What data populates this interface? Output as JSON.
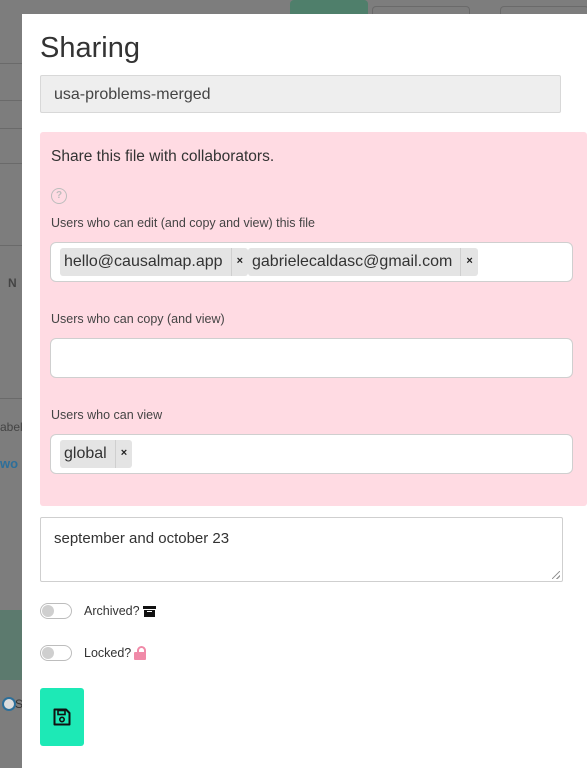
{
  "background": {
    "partial_text_1": "N",
    "partial_text_2": "abel",
    "partial_link": "wo",
    "partial_radio_label": "S"
  },
  "modal": {
    "title": "Sharing",
    "filename": "usa-problems-merged",
    "share_section": {
      "intro": "Share this file with collaborators.",
      "help_icon": "question-circle-icon",
      "editors_label": "Users who can edit (and copy and view) this file",
      "editors": [
        "hello@causalmap.app",
        "gabrielecaldasc@gmail.com"
      ],
      "copiers_label": "Users who can copy (and view)",
      "copiers": [],
      "viewers_label": "Users who can view",
      "viewers": [
        "global"
      ],
      "remove_glyph": "×",
      "background_color": "#ffdbe3"
    },
    "notes": "september and october 23",
    "archived_label": "Archived?",
    "archived": false,
    "archived_icon": "archive-icon",
    "locked_label": "Locked?",
    "locked": false,
    "locked_icon": "lock-icon",
    "save_icon": "floppy-disk-icon",
    "save_color": "#1de9b6"
  }
}
